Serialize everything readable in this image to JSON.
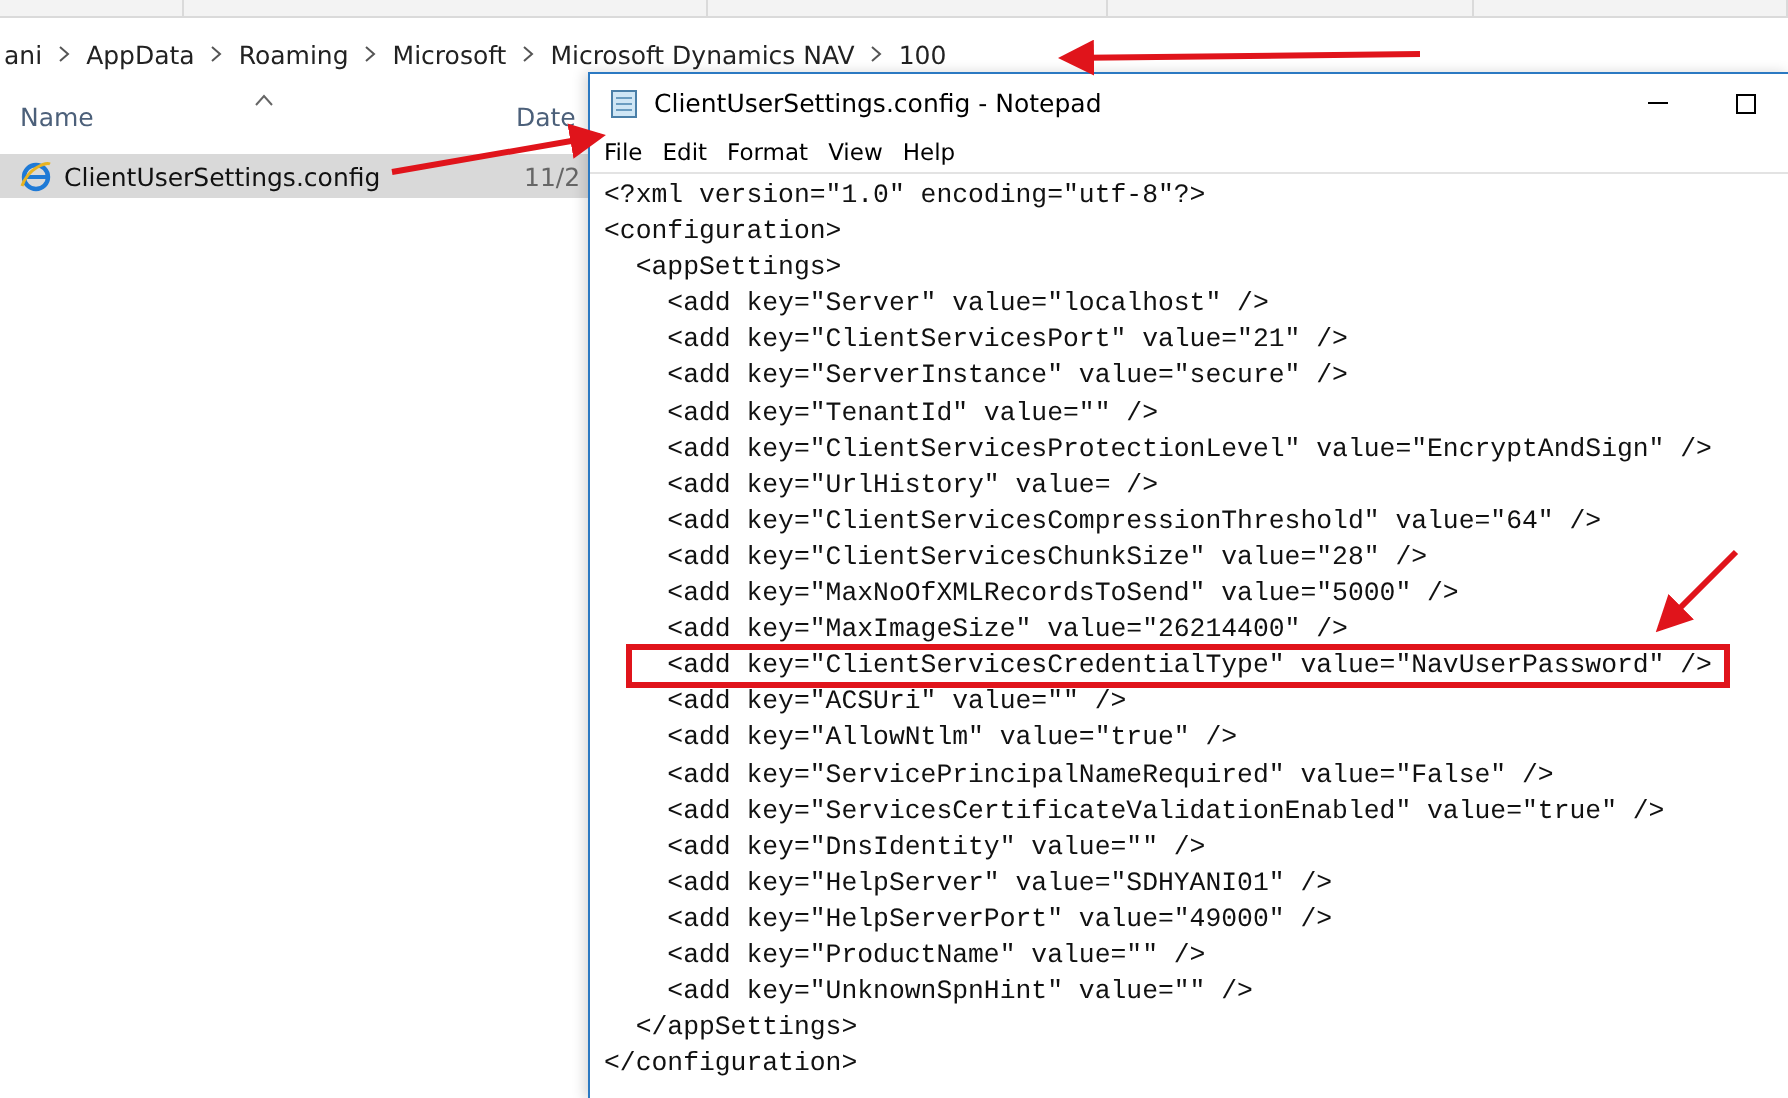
{
  "breadcrumb": [
    "ani",
    "AppData",
    "Roaming",
    "Microsoft",
    "Microsoft Dynamics NAV",
    "100"
  ],
  "file_list": {
    "columns": [
      "Name",
      "Date"
    ],
    "rows": [
      {
        "name": "ClientUserSettings.config",
        "date": "11/2",
        "selected": true
      }
    ]
  },
  "notepad": {
    "title": "ClientUserSettings.config - Notepad",
    "menu": [
      "File",
      "Edit",
      "Format",
      "View",
      "Help"
    ],
    "lines": [
      {
        "text": "<?xml version=\"1.0\" encoding=\"utf-8\"?>",
        "highlighted": false
      },
      {
        "text": "<configuration>",
        "highlighted": false
      },
      {
        "text": "  <appSettings>",
        "highlighted": false
      },
      {
        "text": "    <add key=\"Server\" value=\"localhost\" />",
        "highlighted": false
      },
      {
        "text": "    <add key=\"ClientServicesPort\" value=\"21\" />",
        "highlighted": false
      },
      {
        "text": "    <add key=\"ServerInstance\" value=\"secure\" />",
        "highlighted": false
      },
      {
        "text": "    <add key=\"TenantId\" value=\"\" />",
        "highlighted": false
      },
      {
        "text": "    <add key=\"ClientServicesProtectionLevel\" value=\"EncryptAndSign\" />",
        "highlighted": false
      },
      {
        "text": "    <add key=\"UrlHistory\" value= />",
        "highlighted": false
      },
      {
        "text": "    <add key=\"ClientServicesCompressionThreshold\" value=\"64\" />",
        "highlighted": false
      },
      {
        "text": "    <add key=\"ClientServicesChunkSize\" value=\"28\" />",
        "highlighted": false
      },
      {
        "text": "    <add key=\"MaxNoOfXMLRecordsToSend\" value=\"5000\" />",
        "highlighted": false
      },
      {
        "text": "    <add key=\"MaxImageSize\" value=\"26214400\" />",
        "highlighted": false
      },
      {
        "text": "    <add key=\"ClientServicesCredentialType\" value=\"NavUserPassword\" />",
        "highlighted": true
      },
      {
        "text": "    <add key=\"ACSUri\" value=\"\" />",
        "highlighted": false
      },
      {
        "text": "    <add key=\"AllowNtlm\" value=\"true\" />",
        "highlighted": false
      },
      {
        "text": "    <add key=\"ServicePrincipalNameRequired\" value=\"False\" />",
        "highlighted": false
      },
      {
        "text": "    <add key=\"ServicesCertificateValidationEnabled\" value=\"true\" />",
        "highlighted": false
      },
      {
        "text": "    <add key=\"DnsIdentity\" value=\"\" />",
        "highlighted": false
      },
      {
        "text": "    <add key=\"HelpServer\" value=\"SDHYANI01\" />",
        "highlighted": false
      },
      {
        "text": "    <add key=\"HelpServerPort\" value=\"49000\" />",
        "highlighted": false
      },
      {
        "text": "    <add key=\"ProductName\" value=\"\" />",
        "highlighted": false
      },
      {
        "text": "    <add key=\"UnknownSpnHint\" value=\"\" />",
        "highlighted": false
      },
      {
        "text": "  </appSettings>",
        "highlighted": false
      },
      {
        "text": "</configuration>",
        "highlighted": false
      }
    ]
  }
}
